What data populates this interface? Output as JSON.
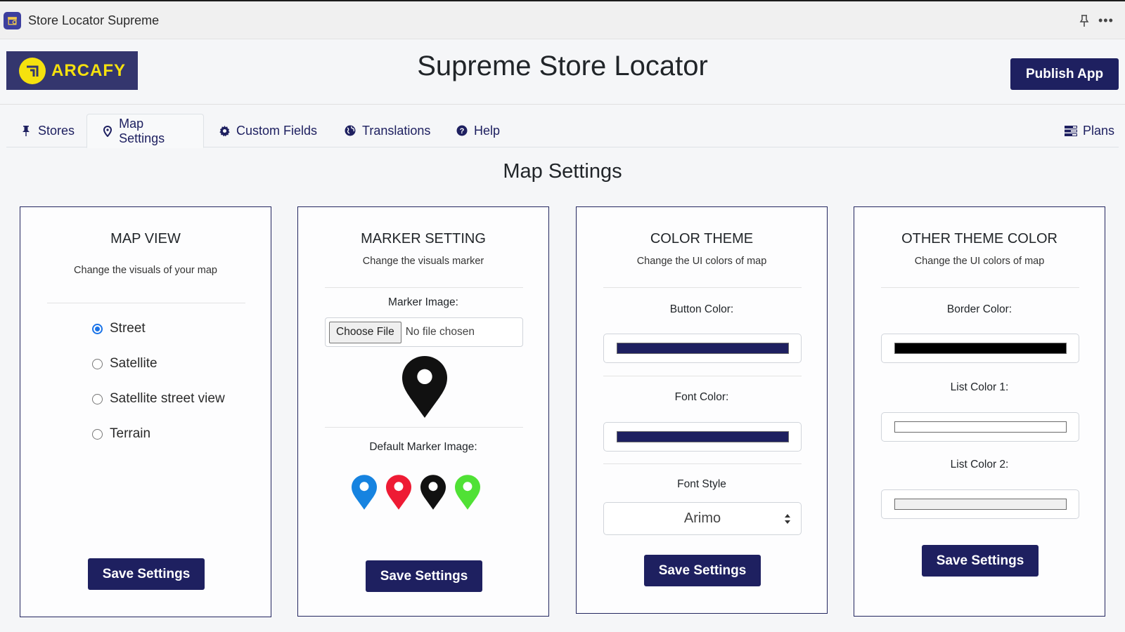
{
  "window": {
    "app_title": "Store Locator Supreme",
    "icons": [
      "app-icon",
      "pin-window-icon",
      "more-options-icon"
    ]
  },
  "header": {
    "logo_text": "ARCAFY",
    "title": "Supreme Store Locator",
    "publish_label": "Publish App"
  },
  "tabs": [
    {
      "label": "Stores",
      "icon": "thumbtack-icon",
      "active": false
    },
    {
      "label": "Map Settings",
      "icon": "map-marker-icon",
      "active": true
    },
    {
      "label": "Custom Fields",
      "icon": "gear-icon",
      "active": false
    },
    {
      "label": "Translations",
      "icon": "globe-icon",
      "active": false
    },
    {
      "label": "Help",
      "icon": "question-circle-icon",
      "active": false
    }
  ],
  "plans": {
    "label": "Plans",
    "icon": "list-icon"
  },
  "section_title": "Map Settings",
  "cards": {
    "map_view": {
      "title": "MAP VIEW",
      "subtitle": "Change the visuals of your map",
      "options": [
        {
          "label": "Street",
          "checked": true
        },
        {
          "label": "Satellite",
          "checked": false
        },
        {
          "label": "Satellite street view",
          "checked": false
        },
        {
          "label": "Terrain",
          "checked": false
        }
      ],
      "save_label": "Save Settings"
    },
    "marker": {
      "title": "MARKER SETTING",
      "subtitle": "Change the visuals marker",
      "marker_image_label": "Marker Image:",
      "choose_file_label": "Choose File",
      "file_status": "No file chosen",
      "current_marker_color": "#111111",
      "default_label": "Default Marker Image:",
      "default_markers": [
        {
          "name": "blue",
          "color": "#1683e0"
        },
        {
          "name": "red",
          "color": "#ee1b34"
        },
        {
          "name": "black",
          "color": "#111111"
        },
        {
          "name": "green",
          "color": "#50e135"
        }
      ],
      "save_label": "Save Settings"
    },
    "color_theme": {
      "title": "COLOR THEME",
      "subtitle": "Change the UI colors of map",
      "button_color_label": "Button Color:",
      "button_color": "#1e2060",
      "font_color_label": "Font Color:",
      "font_color": "#1e2060",
      "font_style_label": "Font Style",
      "font_style_value": "Arimo",
      "save_label": "Save Settings"
    },
    "other_theme": {
      "title": "OTHER THEME COLOR",
      "subtitle": "Change the UI colors of map",
      "border_color_label": "Border Color:",
      "border_color": "#000000",
      "list_color_1_label": "List Color 1:",
      "list_color_1": "#ffffff",
      "list_color_2_label": "List Color 2:",
      "list_color_2": "#f0f0f0",
      "save_label": "Save Settings"
    }
  }
}
